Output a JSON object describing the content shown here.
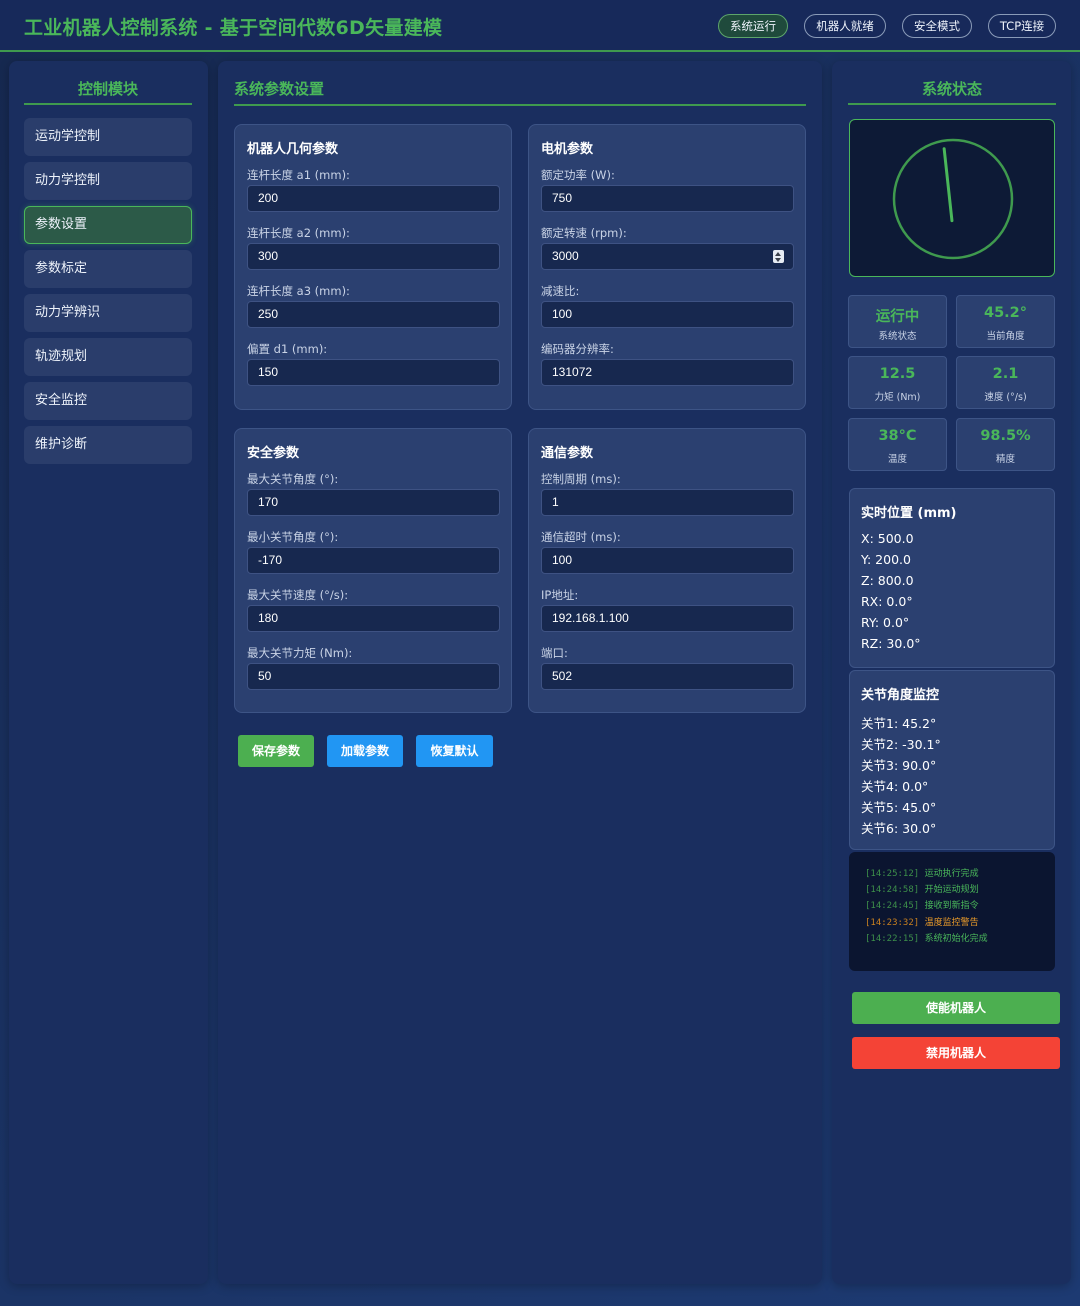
{
  "header": {
    "title": "工业机器人控制系统 - 基于空间代数6D矢量建模",
    "status_pills": [
      "系统运行",
      "机器人就绪",
      "安全模式",
      "TCP连接"
    ]
  },
  "sidebar": {
    "title": "控制模块",
    "items": [
      "运动学控制",
      "动力学控制",
      "参数设置",
      "参数标定",
      "动力学辨识",
      "轨迹规划",
      "安全监控",
      "维护诊断"
    ],
    "active_index": 2
  },
  "main": {
    "title": "系统参数设置",
    "cards": {
      "geometry": {
        "title": "机器人几何参数",
        "fields": [
          {
            "label": "连杆长度 a1 (mm):",
            "value": "200"
          },
          {
            "label": "连杆长度 a2 (mm):",
            "value": "300"
          },
          {
            "label": "连杆长度 a3 (mm):",
            "value": "250"
          },
          {
            "label": "偏置 d1 (mm):",
            "value": "150"
          }
        ]
      },
      "motor": {
        "title": "电机参数",
        "fields": [
          {
            "label": "额定功率 (W):",
            "value": "750"
          },
          {
            "label": "额定转速 (rpm):",
            "value": "3000"
          },
          {
            "label": "减速比:",
            "value": "100"
          },
          {
            "label": "编码器分辨率:",
            "value": "131072"
          }
        ]
      },
      "safety": {
        "title": "安全参数",
        "fields": [
          {
            "label": "最大关节角度 (°):",
            "value": "170"
          },
          {
            "label": "最小关节角度 (°):",
            "value": "-170"
          },
          {
            "label": "最大关节速度 (°/s):",
            "value": "180"
          },
          {
            "label": "最大关节力矩 (Nm):",
            "value": "50"
          }
        ]
      },
      "comm": {
        "title": "通信参数",
        "fields": [
          {
            "label": "控制周期 (ms):",
            "value": "1"
          },
          {
            "label": "通信超时 (ms):",
            "value": "100"
          },
          {
            "label": "IP地址:",
            "value": "192.168.1.100"
          },
          {
            "label": "端口:",
            "value": "502"
          }
        ]
      }
    },
    "buttons": {
      "save": "保存参数",
      "load": "加载参数",
      "reset": "恢复默认"
    }
  },
  "status_panel": {
    "title": "系统状态",
    "gauge": {
      "needle_angle_deg": -10
    },
    "stats": [
      {
        "value": "运行中",
        "label": "系统状态"
      },
      {
        "value": "45.2°",
        "label": "当前角度"
      },
      {
        "value": "12.5",
        "label": "力矩 (Nm)"
      },
      {
        "value": "2.1",
        "label": "速度 (°/s)"
      },
      {
        "value": "38°C",
        "label": "温度"
      },
      {
        "value": "98.5%",
        "label": "精度"
      }
    ],
    "position": {
      "title": "实时位置 (mm)",
      "lines": [
        "X: 500.0",
        "Y: 200.0",
        "Z: 800.0",
        "RX: 0.0°",
        "RY: 0.0°",
        "RZ: 30.0°"
      ]
    },
    "joints": {
      "title": "关节角度监控",
      "lines": [
        "关节1: 45.2°",
        "关节2: -30.1°",
        "关节3: 90.0°",
        "关节4: 0.0°",
        "关节5: 45.0°",
        "关节6: 30.0°"
      ]
    },
    "log": [
      {
        "time": "[14:25:12]",
        "msg": "运动执行完成",
        "warn": false
      },
      {
        "time": "[14:24:58]",
        "msg": "开始运动规划",
        "warn": false
      },
      {
        "time": "[14:24:45]",
        "msg": "接收到新指令",
        "warn": false
      },
      {
        "time": "[14:23:32]",
        "msg": "温度监控警告",
        "warn": true
      },
      {
        "time": "[14:22:15]",
        "msg": "系统初始化完成",
        "warn": false
      }
    ],
    "enable_button": "使能机器人",
    "disable_button": "禁用机器人"
  },
  "colors": {
    "accent_green": "#4ab75a",
    "button_blue": "#2196f3",
    "button_red": "#f44336",
    "warning_orange": "#e89a2a"
  }
}
